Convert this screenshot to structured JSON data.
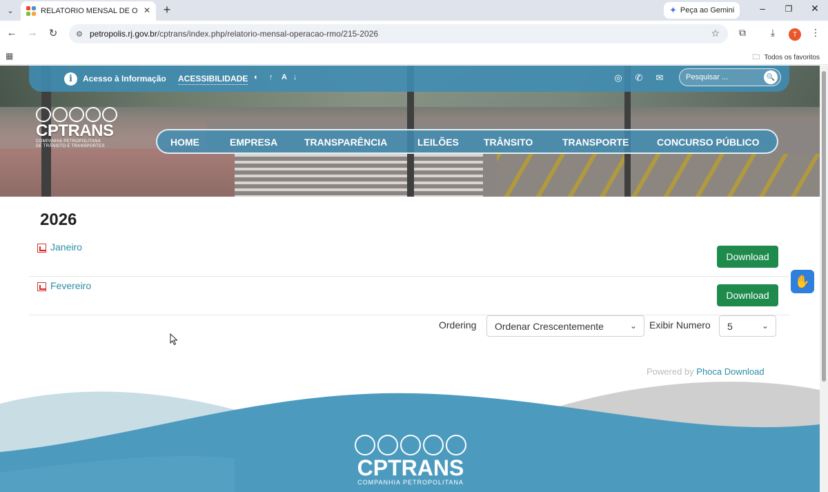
{
  "browser": {
    "tab_title": "RELATÓRIO MENSAL DE OPERAÇÃO",
    "new_tab_symbol": "+",
    "gemini_label": "Peça ao Gemini",
    "url_host": "petropolis.rj.gov.br",
    "url_path": "/cptrans/index.php/relatorio-mensal-operacao-rmo/215-2026",
    "avatar_letter": "T",
    "bookmarks_label": "Todos os favoritos"
  },
  "site": {
    "topbar": {
      "acesso": "Acesso à Informação",
      "acessibilidade": "ACESSIBILIDADE",
      "font_a": "A",
      "search_placeholder": "Pesquisar ..."
    },
    "logo": {
      "brand": "CPTRANS",
      "sub1": "COMPANHIA PETROPOLITANA",
      "sub2": "DE TRÂNSITO E TRANSPORTES"
    },
    "nav": [
      "HOME",
      "EMPRESA",
      "TRANSPARÊNCIA",
      "LEILÕES",
      "TRÂNSITO",
      "TRANSPORTE",
      "CONCURSO PÚBLICO"
    ]
  },
  "content": {
    "year": "2026",
    "files": [
      {
        "name": "Janeiro",
        "button": "Download"
      },
      {
        "name": "Fevereiro",
        "button": "Download"
      }
    ],
    "ordering_label": "Ordering",
    "ordering_value": "Ordenar Crescentemente",
    "exibir_label": "Exibir Numero",
    "exibir_value": "5",
    "powered_prefix": "Powered by",
    "powered_link": "Phoca Download"
  },
  "footer": {
    "brand": "CPTRANS",
    "sub": "COMPANHIA PETROPOLITANA"
  },
  "colors": {
    "accent": "#3f8cb3",
    "download": "#1e8a4c",
    "link": "#2a8ea6"
  }
}
